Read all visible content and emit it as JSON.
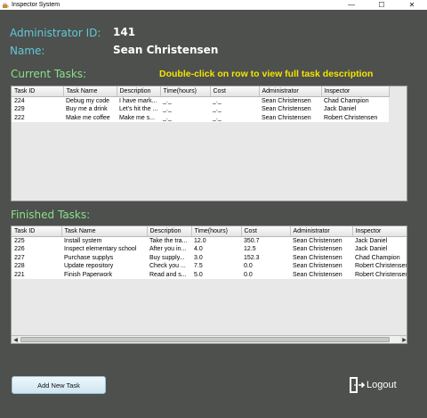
{
  "window": {
    "title": "Inspector System",
    "minimize": "—",
    "maximize": "☐",
    "close": "✕"
  },
  "admin": {
    "id_label": "Administrator ID:",
    "id_value": "141",
    "name_label": "Name:",
    "name_value": "Sean Christensen"
  },
  "current_tasks": {
    "title": "Current Tasks:",
    "hint": "Double-click on row to view full task description",
    "columns": [
      "Task ID",
      "Task Name",
      "Description",
      "Time(hours)",
      "Cost",
      "Administrator",
      "Inspector"
    ],
    "rows": [
      [
        "224",
        "Debug my code",
        "I have mark...",
        "_._",
        "_._",
        "Sean Christensen",
        "Chad Champion"
      ],
      [
        "229",
        "Buy me a drink",
        "Let's hit the ...",
        "_._",
        "_._",
        "Sean Christensen",
        "Jack Daniel"
      ],
      [
        "222",
        "Make me coffee",
        "Make me s...",
        "_._",
        "_._",
        "Sean Christensen",
        "Robert Christensen"
      ]
    ]
  },
  "finished_tasks": {
    "title": "Finished Tasks:",
    "columns": [
      "Task ID",
      "Task Name",
      "Description",
      "Time(hours)",
      "Cost",
      "Administrator",
      "Inspector"
    ],
    "rows": [
      [
        "225",
        "Install system",
        "Take the tra...",
        "12.0",
        "350.7",
        "Sean Christensen",
        "Jack Daniel"
      ],
      [
        "226",
        "Inspect elementary school",
        "After you in...",
        "4.0",
        "12.5",
        "Sean Christensen",
        "Jack Daniel"
      ],
      [
        "227",
        "Purchase supplys",
        "Buy supply...",
        "3.0",
        "152.3",
        "Sean Christensen",
        "Chad Champion"
      ],
      [
        "228",
        "Update repository",
        "Check you ...",
        "7.5",
        "0.0",
        "Sean Christensen",
        "Robert Christensen"
      ],
      [
        "221",
        "Finish Paperwork",
        "Read and s...",
        "5.0",
        "0.0",
        "Sean Christensen",
        "Robert Christensen"
      ]
    ]
  },
  "actions": {
    "add_task": "Add New Task",
    "logout": "Logout"
  },
  "colors": {
    "background": "#4d504d",
    "label_cyan": "#62c9d8",
    "section_green": "#8be08b",
    "hint_yellow": "#f5e400"
  },
  "icons": {
    "app": "coffee-cup-icon",
    "logout": "door-exit-icon",
    "scroll_left": "arrow-left-icon",
    "scroll_right": "arrow-right-icon"
  }
}
